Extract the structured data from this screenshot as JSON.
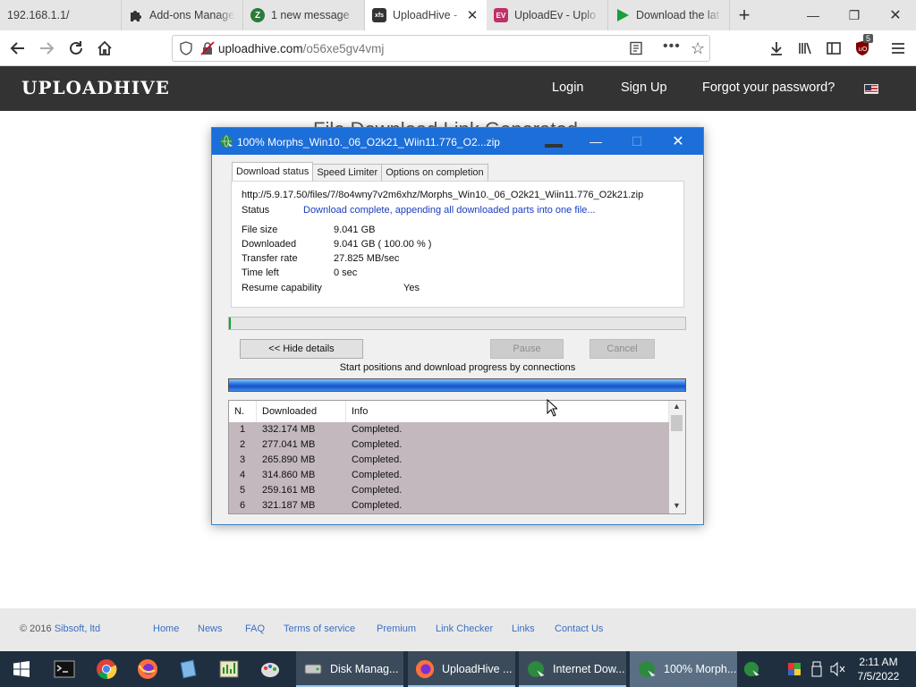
{
  "browser": {
    "tabs": [
      {
        "title": "192.168.1.1/",
        "active": false
      },
      {
        "title": "Add-ons Manager",
        "active": false
      },
      {
        "title": "1 new message",
        "active": false
      },
      {
        "title": "UploadHive - ",
        "active": true
      },
      {
        "title": "UploadEv - Uplo",
        "active": false
      },
      {
        "title": "Download the lat",
        "active": false
      }
    ],
    "url_domain": "uploadhive.com",
    "url_path": "/o56xe5gv4vmj",
    "extension_badge": "5"
  },
  "site": {
    "logo": "UPLOADHIVE",
    "nav": {
      "login": "Login",
      "signup": "Sign Up",
      "forgot": "Forgot your password?"
    },
    "page_title": "File Download Link Generated",
    "footer": {
      "copyright": "© 2016 ",
      "company": "Sibsoft, ltd",
      "links": [
        "Home",
        "News",
        "FAQ",
        "Terms of service",
        "Premium",
        "Link Checker",
        "Links",
        "Contact Us"
      ]
    }
  },
  "idm": {
    "title": "100% Morphs_Win10._06_O2k21_Wiin11.776_O2...zip",
    "tabs": [
      "Download status",
      "Speed Limiter",
      "Options on completion"
    ],
    "url": "http://5.9.17.50/files/7/8o4wny7v2m6xhz/Morphs_Win10._06_O2k21_Wiin11.776_O2k21.zip",
    "status_label": "Status",
    "status_value": "Download complete, appending all downloaded parts into one file...",
    "file_size_label": "File size",
    "file_size_value": "9.041  GB",
    "downloaded_label": "Downloaded",
    "downloaded_value": "9.041  GB  ( 100.00 % )",
    "transfer_rate_label": "Transfer rate",
    "transfer_rate_value": "27.825  MB/sec",
    "time_left_label": "Time left",
    "time_left_value": "0 sec",
    "resume_label": "Resume capability",
    "resume_value": "Yes",
    "progress_fraction": 0.004,
    "buttons": {
      "hide_details": "<< Hide details",
      "pause": "Pause",
      "cancel": "Cancel"
    },
    "connections_caption": "Start positions and download progress by connections",
    "table_headers": [
      "N.",
      "Downloaded",
      "Info"
    ],
    "connections": [
      {
        "n": "1",
        "downloaded": "332.174  MB",
        "info": "Completed."
      },
      {
        "n": "2",
        "downloaded": "277.041  MB",
        "info": "Completed."
      },
      {
        "n": "3",
        "downloaded": "265.890  MB",
        "info": "Completed."
      },
      {
        "n": "4",
        "downloaded": "314.860  MB",
        "info": "Completed."
      },
      {
        "n": "5",
        "downloaded": "259.161  MB",
        "info": "Completed."
      },
      {
        "n": "6",
        "downloaded": "321.187  MB",
        "info": "Completed."
      }
    ]
  },
  "taskbar": {
    "items": [
      {
        "label": "Disk Manag...",
        "state": "open"
      },
      {
        "label": "UploadHive ...",
        "state": "open"
      },
      {
        "label": "Internet Dow...",
        "state": "open"
      },
      {
        "label": "100% Morph...",
        "state": "active"
      }
    ],
    "time": "2:11 AM",
    "date": "7/5/2022"
  },
  "colors": {
    "site_header": "#333333",
    "idm_titlebar": "#1c6ed8",
    "taskbar": "#1f2f3f",
    "progress_green": "#06b025"
  }
}
